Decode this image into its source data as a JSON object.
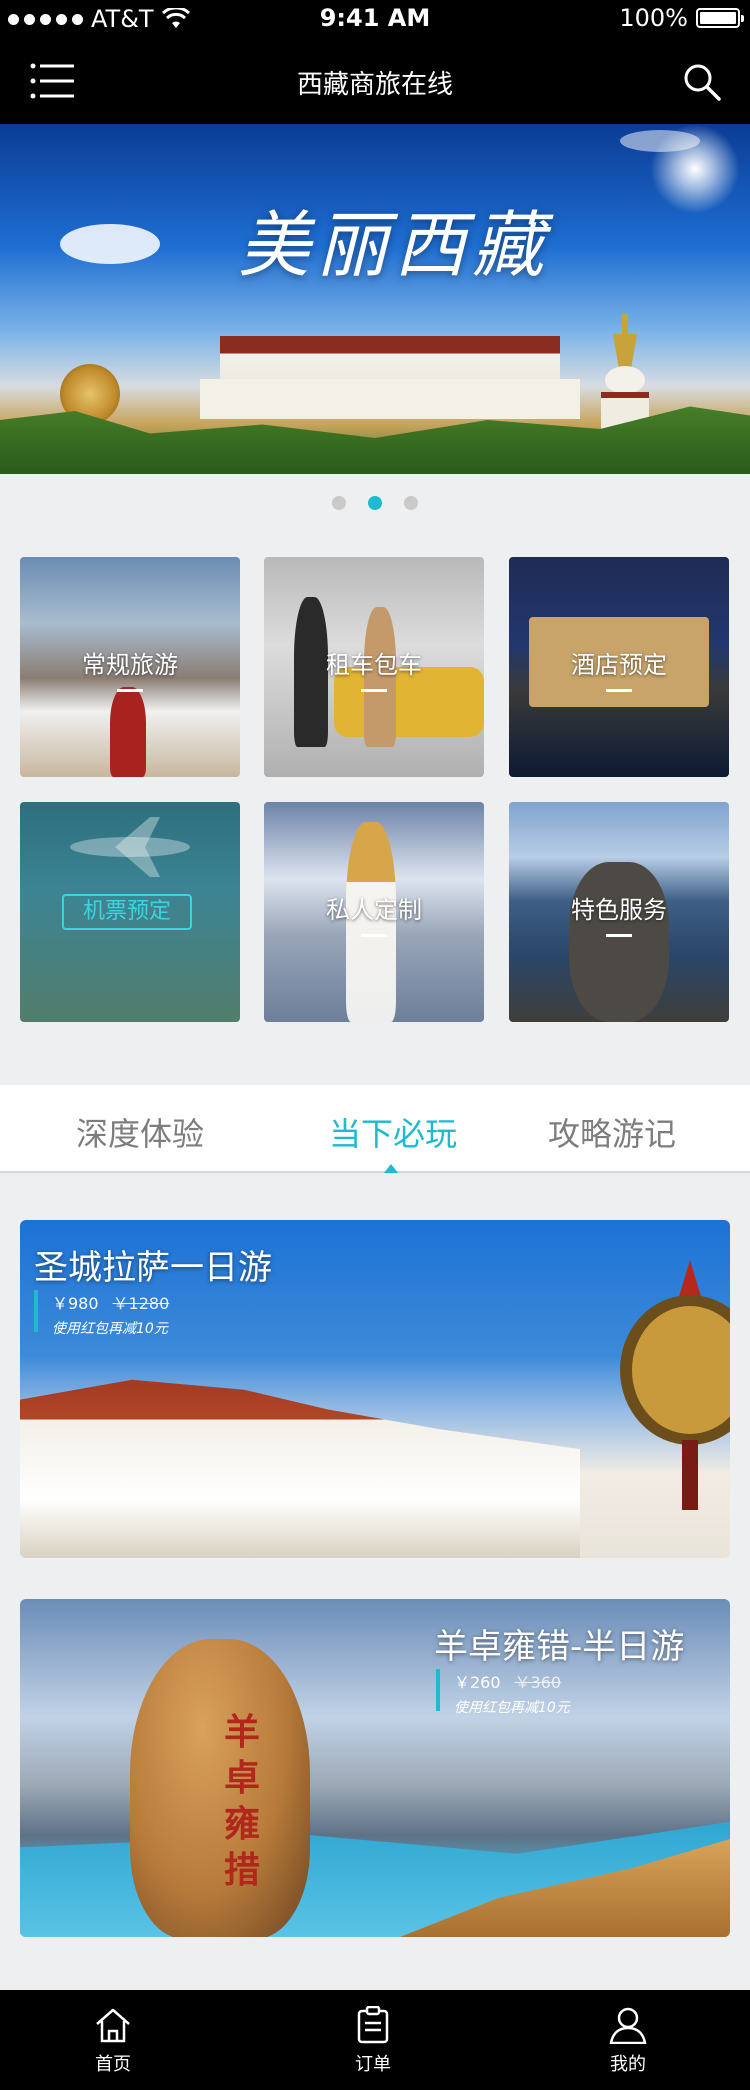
{
  "status_bar": {
    "carrier": "AT&T",
    "time": "9:41 AM",
    "battery": "100%"
  },
  "nav": {
    "title": "西藏商旅在线"
  },
  "banner": {
    "title": "美丽西藏",
    "pages": 3,
    "active_page": 2
  },
  "services": [
    {
      "label": "常规旅游"
    },
    {
      "label": "租车包车"
    },
    {
      "label": "酒店预定"
    },
    {
      "label": "机票预定"
    },
    {
      "label": "私人定制"
    },
    {
      "label": "特色服务"
    }
  ],
  "tabs": [
    {
      "label": "深度体验"
    },
    {
      "label": "当下必玩",
      "active": true
    },
    {
      "label": "攻略游记"
    }
  ],
  "tours": [
    {
      "title": "圣城拉萨一日游",
      "price": "￥980",
      "original_price": "￥1280",
      "promo": "使用红包再减10元"
    },
    {
      "title": "羊卓雍错-半日游",
      "price": "￥260",
      "original_price": "￥360",
      "promo": "使用红包再减10元",
      "stone_text": "羊卓雍措"
    }
  ],
  "tabbar": [
    {
      "label": "首页",
      "icon": "home-icon"
    },
    {
      "label": "订单",
      "icon": "order-icon"
    },
    {
      "label": "我的",
      "icon": "profile-icon"
    }
  ],
  "colors": {
    "accent": "#1dbad0",
    "nav_bg": "#000000",
    "page_bg": "#eeeff1"
  }
}
